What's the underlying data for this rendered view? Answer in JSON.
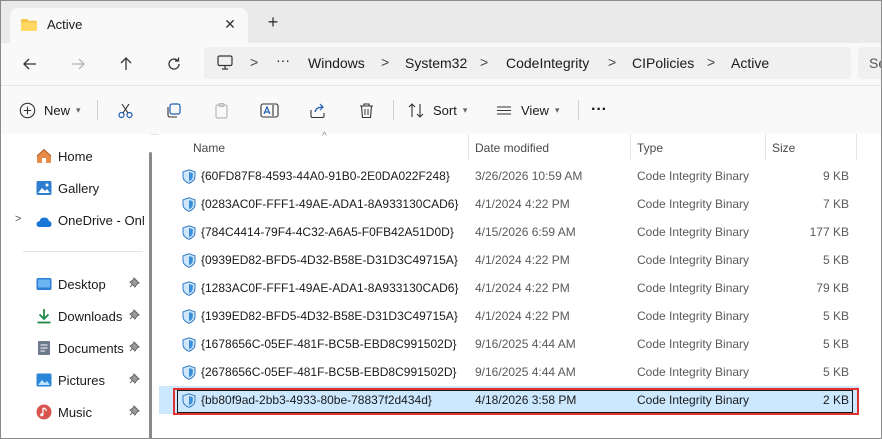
{
  "tab": {
    "title": "Active",
    "close_label": "✕",
    "new_tab_label": "+"
  },
  "address": {
    "crumbs": [
      "Windows",
      "System32",
      "CodeIntegrity",
      "CIPolicies",
      "Active"
    ],
    "ellipsis": "···",
    "separator": ">",
    "search_partial": "Se"
  },
  "toolbar": {
    "new_label": "New",
    "sort_label": "Sort",
    "view_label": "View",
    "more_label": "···"
  },
  "sidebar": {
    "items": [
      {
        "label": "Home",
        "icon": "home-icon",
        "pinned": false
      },
      {
        "label": "Gallery",
        "icon": "gallery-icon",
        "pinned": false
      },
      {
        "label": "OneDrive - OnM",
        "icon": "onedrive-icon",
        "pinned": false,
        "expander": ">"
      },
      {
        "label": "Desktop",
        "icon": "desktop-icon",
        "pinned": true
      },
      {
        "label": "Downloads",
        "icon": "downloads-icon",
        "pinned": true
      },
      {
        "label": "Documents",
        "icon": "documents-icon",
        "pinned": true
      },
      {
        "label": "Pictures",
        "icon": "pictures-icon",
        "pinned": true
      },
      {
        "label": "Music",
        "icon": "music-icon",
        "pinned": true
      }
    ]
  },
  "columns": {
    "name": "Name",
    "date": "Date modified",
    "type": "Type",
    "size": "Size"
  },
  "files": [
    {
      "name": "{60FD87F8-4593-44A0-91B0-2E0DA022F248}",
      "date": "3/26/2026 10:59 AM",
      "type": "Code Integrity Binary",
      "size": "9 KB"
    },
    {
      "name": "{0283AC0F-FFF1-49AE-ADA1-8A933130CAD6}",
      "date": "4/1/2024 4:22 PM",
      "type": "Code Integrity Binary",
      "size": "7 KB"
    },
    {
      "name": "{784C4414-79F4-4C32-A6A5-F0FB42A51D0D}",
      "date": "4/15/2026 6:59 AM",
      "type": "Code Integrity Binary",
      "size": "177 KB"
    },
    {
      "name": "{0939ED82-BFD5-4D32-B58E-D31D3C49715A}",
      "date": "4/1/2024 4:22 PM",
      "type": "Code Integrity Binary",
      "size": "5 KB"
    },
    {
      "name": "{1283AC0F-FFF1-49AE-ADA1-8A933130CAD6}",
      "date": "4/1/2024 4:22 PM",
      "type": "Code Integrity Binary",
      "size": "79 KB"
    },
    {
      "name": "{1939ED82-BFD5-4D32-B58E-D31D3C49715A}",
      "date": "4/1/2024 4:22 PM",
      "type": "Code Integrity Binary",
      "size": "5 KB"
    },
    {
      "name": "{1678656C-05EF-481F-BC5B-EBD8C991502D}",
      "date": "9/16/2025 4:44 AM",
      "type": "Code Integrity Binary",
      "size": "5 KB"
    },
    {
      "name": "{2678656C-05EF-481F-BC5B-EBD8C991502D}",
      "date": "9/16/2025 4:44 AM",
      "type": "Code Integrity Binary",
      "size": "5 KB"
    },
    {
      "name": "{bb80f9ad-2bb3-4933-80be-78837f2d434d}",
      "date": "4/18/2026 3:58 PM",
      "type": "Code Integrity Binary",
      "size": "2 KB",
      "selected": true
    }
  ],
  "colors": {
    "selection": "#cce8ff",
    "highlight_border": "#e03030",
    "accent": "#0067c0"
  }
}
